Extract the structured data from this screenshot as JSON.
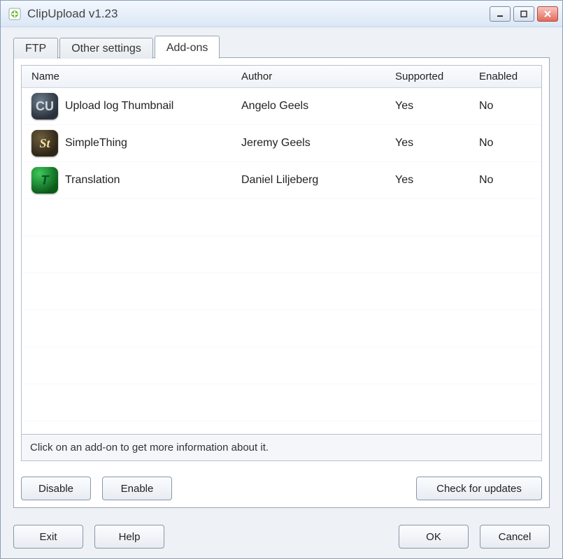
{
  "window": {
    "title": "ClipUpload v1.23"
  },
  "tabs": [
    {
      "label": "FTP"
    },
    {
      "label": "Other settings"
    },
    {
      "label": "Add-ons"
    }
  ],
  "columns": {
    "name": "Name",
    "author": "Author",
    "supported": "Supported",
    "enabled": "Enabled"
  },
  "addons": [
    {
      "icon": "cu",
      "icon_text": "CU",
      "name": "Upload log Thumbnail",
      "author": "Angelo Geels",
      "supported": "Yes",
      "enabled": "No"
    },
    {
      "icon": "st",
      "icon_text": "St",
      "name": "SimpleThing",
      "author": "Jeremy Geels",
      "supported": "Yes",
      "enabled": "No"
    },
    {
      "icon": "tr",
      "icon_text": "T",
      "name": "Translation",
      "author": "Daniel Liljeberg",
      "supported": "Yes",
      "enabled": "No"
    }
  ],
  "info_text": "Click on an add-on to get more information about it.",
  "buttons": {
    "disable": "Disable",
    "enable": "Enable",
    "check_updates": "Check for updates",
    "exit": "Exit",
    "help": "Help",
    "ok": "OK",
    "cancel": "Cancel"
  }
}
